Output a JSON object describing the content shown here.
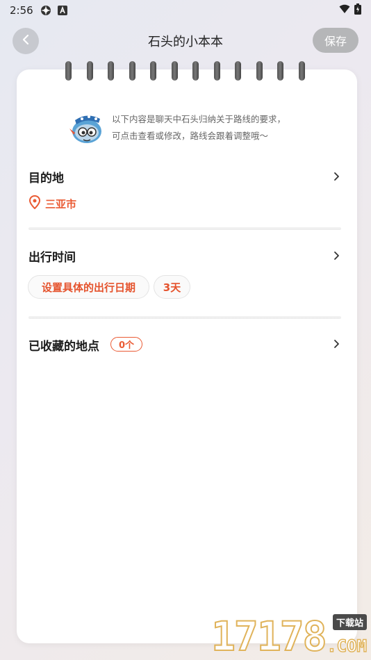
{
  "status_bar": {
    "time": "2:56",
    "icons": [
      "gear-app-icon",
      "a-app-icon"
    ],
    "right_icons": [
      "wifi-icon",
      "battery-icon"
    ]
  },
  "header": {
    "title": "石头的小本本",
    "save_label": "保存",
    "back_icon": "chevron-left-icon"
  },
  "notebook": {
    "intro_line1": "以下内容是聊天中石头归纳关于路线的要求，",
    "intro_line2": "可点击查看或修改，路线会跟着调整哦～",
    "sections": {
      "destination": {
        "title": "目的地",
        "value": "三亚市",
        "icon": "location-pin-icon"
      },
      "travel_time": {
        "title": "出行时间",
        "date_chip": "设置具体的出行日期",
        "days_chip": "3天"
      },
      "saved_places": {
        "title": "已收藏的地点",
        "count": "0个"
      }
    }
  },
  "watermark": {
    "digits": "17178",
    "tag": "下载站",
    "com": ".COM"
  },
  "colors": {
    "accent": "#ea5a33",
    "save_button": "#b5b6b8",
    "back_button": "#c7c9cf"
  }
}
